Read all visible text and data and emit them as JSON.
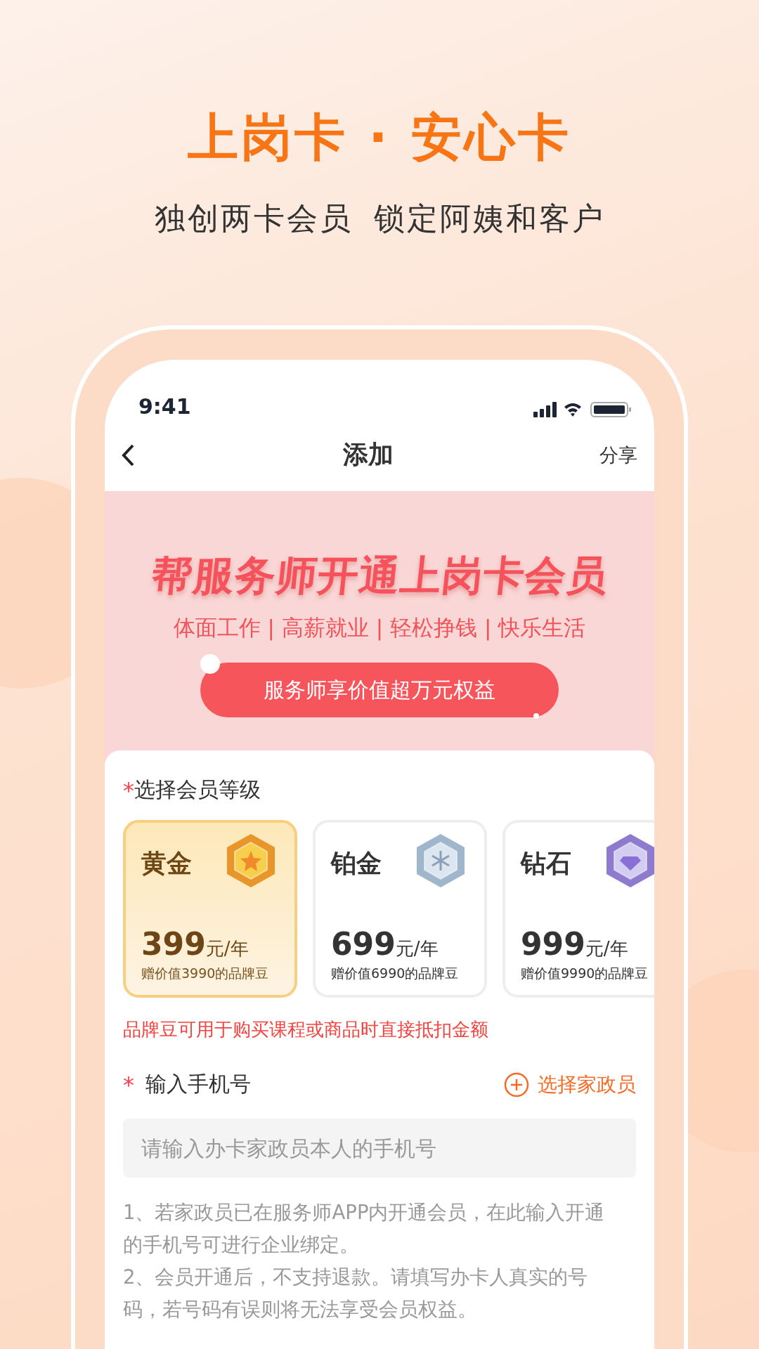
{
  "promo": {
    "title": "上岗卡 · 安心卡",
    "subtitle": [
      "独创两卡会员",
      "锁定阿姨和客户"
    ]
  },
  "status_bar": {
    "time": "9:41"
  },
  "nav": {
    "title": "添加",
    "action": "分享"
  },
  "banner": {
    "headline": "帮服务师开通上岗卡会员",
    "tagline": "体面工作 | 高薪就业 | 轻松挣钱 | 快乐生活",
    "button": "服务师享价值超万元权益"
  },
  "level_section": {
    "required_mark": "*",
    "label": "选择会员等级",
    "tiers": [
      {
        "kind": "gold",
        "name": "黄金",
        "price": "399",
        "unit": "元/年",
        "bonus": "赠价值3990的品牌豆",
        "selected": true
      },
      {
        "kind": "platinum",
        "name": "铂金",
        "price": "699",
        "unit": "元/年",
        "bonus": "赠价值6990的品牌豆",
        "selected": false
      },
      {
        "kind": "diamond",
        "name": "钻石",
        "price": "999",
        "unit": "元/年",
        "bonus": "赠价值9990的品牌豆",
        "selected": false
      }
    ],
    "note": "品牌豆可用于购买课程或商品时直接抵扣金额"
  },
  "phone_section": {
    "required_mark": "*",
    "label": "输入手机号",
    "pick_button": "选择家政员",
    "placeholder": "请输入办卡家政员本人的手机号",
    "notes": [
      "1、若家政员已在服务师APP内开通会员，在此输入开通的手机号可进行企业绑定。",
      "2、会员开通后，不支持退款。请填写办卡人真实的号码，若号码有误则将无法享受会员权益。"
    ]
  }
}
